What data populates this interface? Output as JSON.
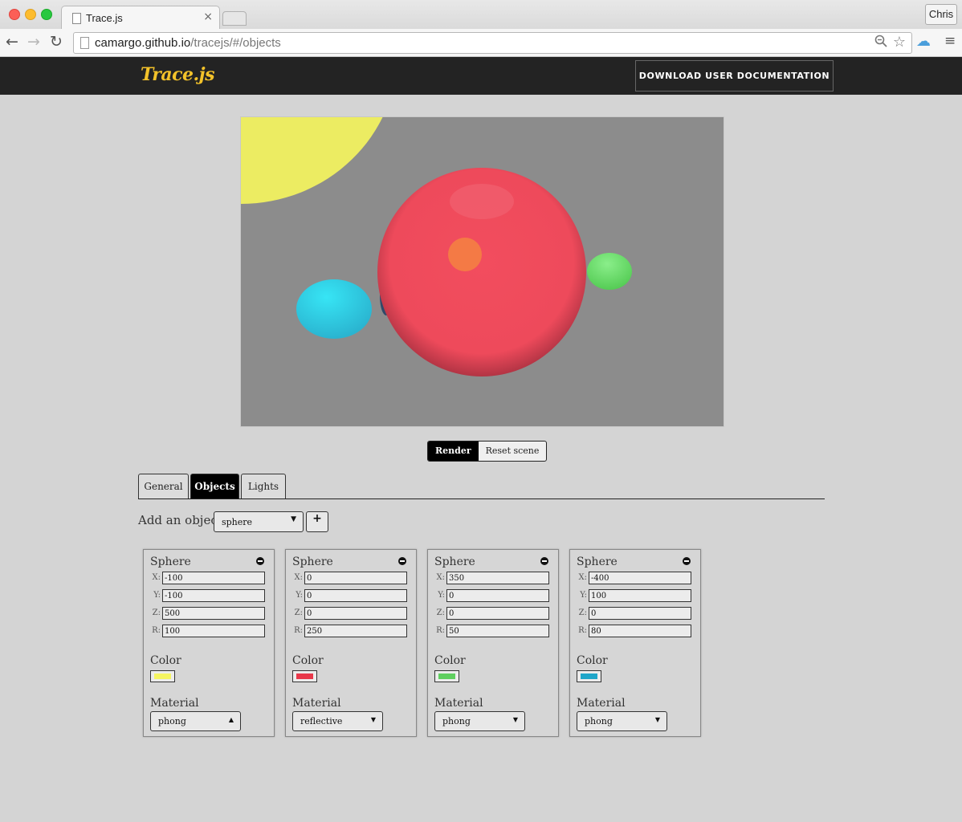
{
  "browser": {
    "tab_title": "Trace.js",
    "tab_close": "×",
    "profile": "Chris",
    "url_host": "camargo.github.io",
    "url_path": "/tracejs/#/objects",
    "icons": {
      "back": "←",
      "forward": "→",
      "reload": "↻",
      "zoom": "🔍",
      "star": "☆",
      "cloud": "☁",
      "menu": "≡"
    }
  },
  "header": {
    "logo": "Trace.js",
    "doc_button": "DOWNLOAD USER DOCUMENTATION"
  },
  "controls": {
    "render": "Render",
    "reset": "Reset scene"
  },
  "tabs": [
    {
      "label": "General",
      "active": false
    },
    {
      "label": "Objects",
      "active": true
    },
    {
      "label": "Lights",
      "active": false
    }
  ],
  "add_object": {
    "label": "Add an object:",
    "selected": "sphere",
    "caret": "▼",
    "add_button": "+"
  },
  "objects": [
    {
      "title": "Sphere",
      "x": "-100",
      "y": "-100",
      "z": "500",
      "r": "100",
      "color_label": "Color",
      "color": "#f5f562",
      "material_label": "Material",
      "material": "phong",
      "caret": "▲"
    },
    {
      "title": "Sphere",
      "x": "0",
      "y": "0",
      "z": "0",
      "r": "250",
      "color_label": "Color",
      "color": "#e8384a",
      "material_label": "Material",
      "material": "reflective",
      "caret": "▼"
    },
    {
      "title": "Sphere",
      "x": "350",
      "y": "0",
      "z": "0",
      "r": "50",
      "color_label": "Color",
      "color": "#5fcf5f",
      "material_label": "Material",
      "material": "phong",
      "caret": "▼"
    },
    {
      "title": "Sphere",
      "x": "-400",
      "y": "100",
      "z": "0",
      "r": "80",
      "color_label": "Color",
      "color": "#1fa6c9",
      "material_label": "Material",
      "material": "phong",
      "caret": "▼"
    }
  ],
  "field_labels": {
    "x": "X:",
    "y": "Y:",
    "z": "Z:",
    "r": "R:"
  },
  "colors": {
    "header_bg": "#232323",
    "logo": "#f3c22a",
    "canvas_bg": "#8c8c8c",
    "page_bg": "#d4d4d4"
  }
}
